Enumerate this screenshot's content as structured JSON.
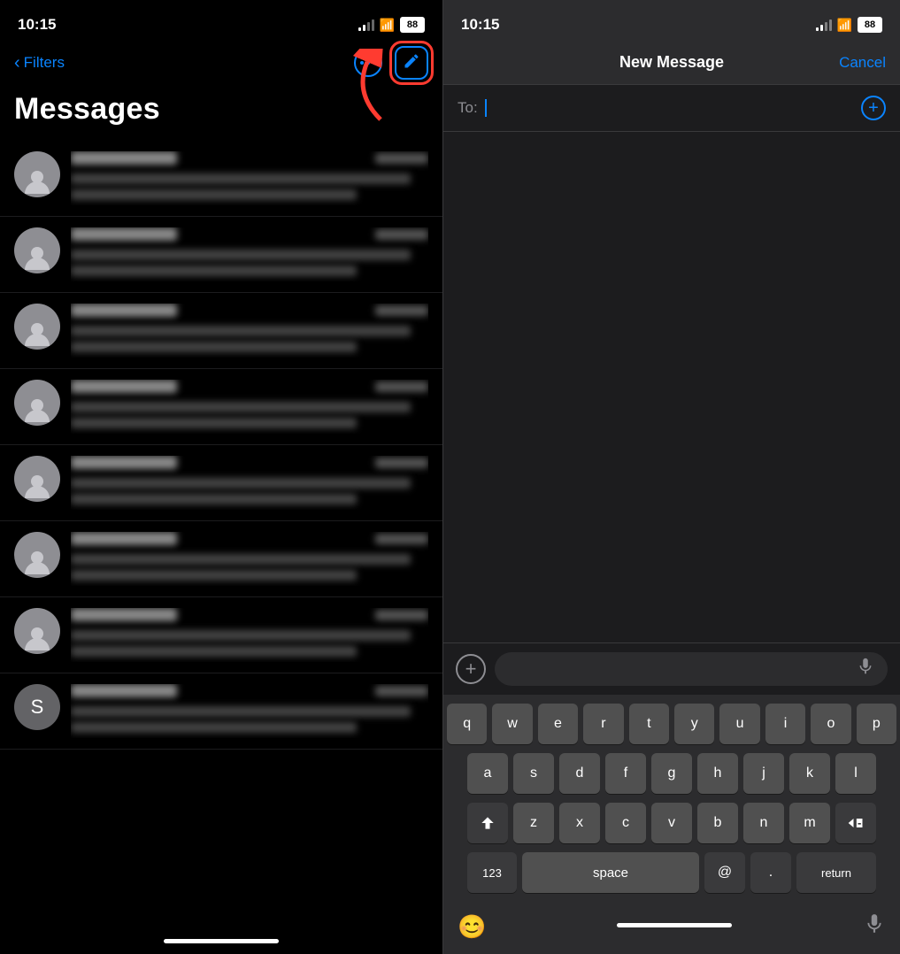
{
  "left": {
    "status_time": "10:15",
    "battery": "88",
    "filters_label": "Filters",
    "messages_title": "Messages",
    "messages": [
      {
        "id": 1,
        "avatar_type": "person"
      },
      {
        "id": 2,
        "avatar_type": "person"
      },
      {
        "id": 3,
        "avatar_type": "person"
      },
      {
        "id": 4,
        "avatar_type": "person"
      },
      {
        "id": 5,
        "avatar_type": "person"
      },
      {
        "id": 6,
        "avatar_type": "person"
      },
      {
        "id": 7,
        "avatar_type": "person"
      },
      {
        "id": 8,
        "avatar_type": "person"
      },
      {
        "id": 9,
        "avatar_type": "letter",
        "letter": "S"
      }
    ]
  },
  "right": {
    "status_time": "10:15",
    "battery": "88",
    "title": "New Message",
    "cancel_label": "Cancel",
    "to_label": "To:",
    "keyboard": {
      "row1": [
        "q",
        "w",
        "e",
        "r",
        "t",
        "y",
        "u",
        "i",
        "o",
        "p"
      ],
      "row2": [
        "a",
        "s",
        "d",
        "f",
        "g",
        "h",
        "j",
        "k",
        "l"
      ],
      "row3": [
        "z",
        "x",
        "c",
        "v",
        "b",
        "n",
        "m"
      ],
      "row4_left": "123",
      "row4_space": "space",
      "row4_at": "@",
      "row4_dot": ".",
      "row4_return": "return"
    }
  }
}
